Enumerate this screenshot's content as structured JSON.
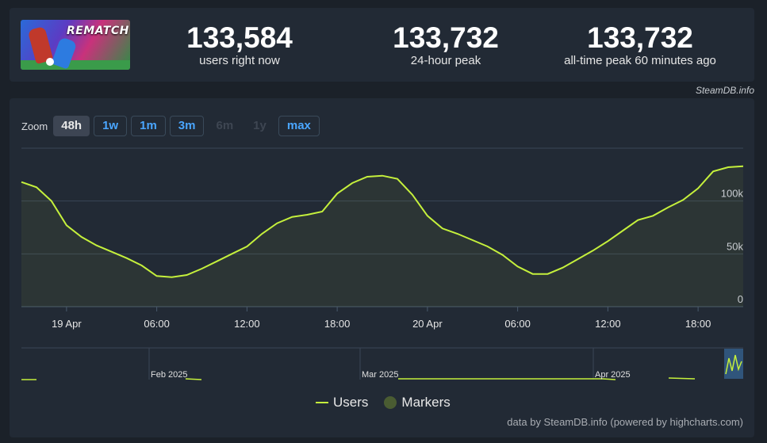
{
  "header": {
    "game_logo_text": "REMATCH",
    "stats": [
      {
        "value": "133,584",
        "label": "users right now"
      },
      {
        "value": "133,732",
        "label": "24-hour peak"
      },
      {
        "value": "133,732",
        "label": "all-time peak 60 minutes ago"
      }
    ],
    "brand": "SteamDB.info"
  },
  "zoom": {
    "label": "Zoom",
    "buttons": [
      {
        "label": "48h",
        "state": "active"
      },
      {
        "label": "1w",
        "state": "enabled"
      },
      {
        "label": "1m",
        "state": "enabled"
      },
      {
        "label": "3m",
        "state": "enabled"
      },
      {
        "label": "6m",
        "state": "disabled"
      },
      {
        "label": "1y",
        "state": "disabled"
      },
      {
        "label": "max",
        "state": "enabled"
      }
    ]
  },
  "legend": {
    "users": "Users",
    "markers": "Markers"
  },
  "credit": "data by SteamDB.info (powered by highcharts.com)",
  "colors": {
    "line": "#c5f03c",
    "enabled_button": "#4aa6ff",
    "panel": "#222a35"
  },
  "chart_data": {
    "type": "line",
    "series": [
      {
        "name": "Users",
        "x_hours": [
          0,
          1,
          2,
          3,
          4,
          5,
          6,
          7,
          8,
          9,
          10,
          11,
          12,
          13,
          14,
          15,
          16,
          17,
          18,
          19,
          20,
          21,
          22,
          23,
          24,
          25,
          26,
          27,
          28,
          29,
          30,
          31,
          32,
          33,
          34,
          35,
          36,
          37,
          38,
          39,
          40,
          41,
          42,
          43,
          44,
          45,
          46,
          47,
          48
        ],
        "values": [
          118,
          113,
          100,
          77,
          66,
          58,
          52,
          46,
          39,
          29,
          28,
          30,
          36,
          43,
          50,
          57,
          69,
          79,
          85,
          87,
          90,
          107,
          117,
          123,
          124,
          121,
          106,
          86,
          74,
          69,
          63,
          57,
          49,
          38,
          31,
          31,
          37,
          45,
          53,
          62,
          72,
          82,
          86,
          94,
          101,
          112,
          128,
          132,
          133
        ]
      }
    ],
    "x_tick_labels": [
      "19 Apr",
      "06:00",
      "12:00",
      "18:00",
      "20 Apr",
      "06:00",
      "12:00",
      "18:00"
    ],
    "x_tick_hours": [
      3,
      9,
      15,
      21,
      27,
      33,
      39,
      45
    ],
    "y_tick_labels": [
      "0",
      "50k",
      "100k"
    ],
    "y_tick_values": [
      0,
      50,
      100
    ],
    "ylim": [
      0,
      150
    ],
    "unit_scale": "thousands",
    "grid": true,
    "legend_position": "bottom-center",
    "navigator": {
      "labels": [
        "Feb 2025",
        "Mar 2025",
        "Apr 2025"
      ]
    }
  }
}
